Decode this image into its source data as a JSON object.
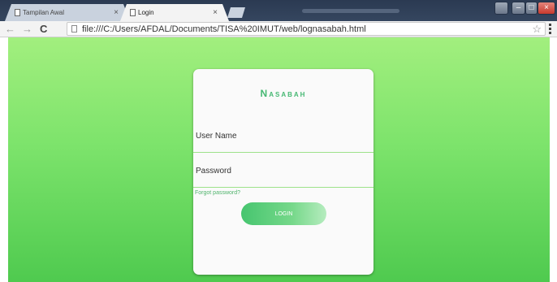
{
  "browser": {
    "tabs": [
      {
        "title": "Tampilan Awal",
        "close": "×",
        "active": false
      },
      {
        "title": "Login",
        "close": "×",
        "active": true
      }
    ],
    "nav": {
      "back": "←",
      "forward": "→",
      "reload": "C"
    },
    "url": "file:///C:/Users/AFDAL/Documents/TISA%20IMUT/web/lognasabah.html",
    "bookmark_icon": "☆",
    "window_controls": {
      "minimize": "–",
      "maximize": "□",
      "close": "×"
    }
  },
  "login_card": {
    "title": "Nasabah",
    "fields": [
      {
        "label": "User Name"
      },
      {
        "label": "Password"
      }
    ],
    "forgot_password": "Forgot password?",
    "login_button": "LOGIN"
  },
  "colors": {
    "accent_green": "#46b873",
    "background_top": "#a2ef7e",
    "background_bottom": "#4fca4f",
    "card": "#fafafa"
  }
}
